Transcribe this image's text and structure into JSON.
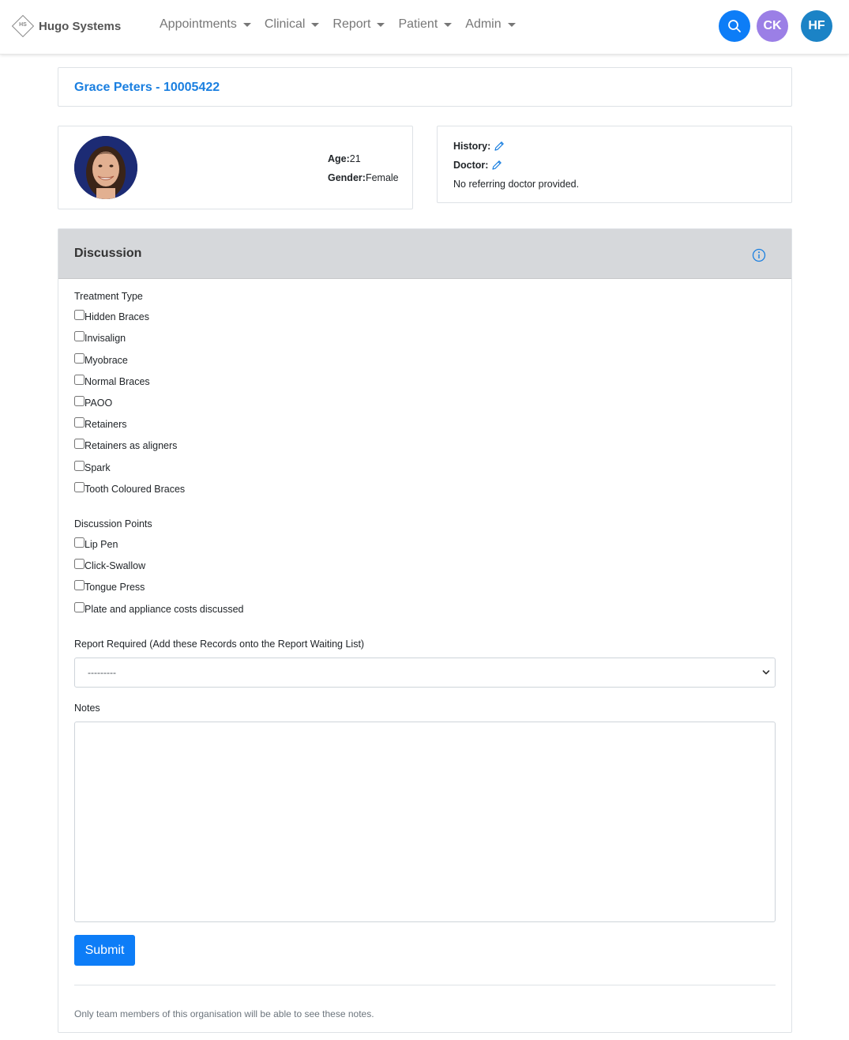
{
  "navbar": {
    "logo_text": "HS",
    "brand": "Hugo Systems",
    "menu": [
      {
        "label": "Appointments"
      },
      {
        "label": "Clinical"
      },
      {
        "label": "Report"
      },
      {
        "label": "Patient"
      },
      {
        "label": "Admin"
      }
    ],
    "user_initials_1": "CK",
    "user_initials_2": "HF",
    "accent_color": "#0d7df7"
  },
  "patient": {
    "title": "Grace Peters - 10005422",
    "age_label": "Age:",
    "age_value": "21",
    "gender_label": "Gender:",
    "gender_value": "Female",
    "history_label": "History:",
    "doctor_label": "Doctor:",
    "doctor_value": "No referring doctor provided."
  },
  "discussion": {
    "title": "Discussion",
    "treatment_type_label": "Treatment Type",
    "treatment_types": [
      "Hidden Braces",
      "Invisalign",
      "Myobrace",
      "Normal Braces",
      "PAOO",
      "Retainers",
      "Retainers as aligners",
      "Spark",
      "Tooth Coloured Braces"
    ],
    "discussion_points_label": "Discussion Points",
    "discussion_points": [
      "Lip Pen",
      "Click-Swallow",
      "Tongue Press",
      "Plate and appliance costs discussed"
    ],
    "report_required_label": "Report Required (Add these Records onto the Report Waiting List)",
    "report_required_value": "---------",
    "notes_label": "Notes",
    "notes_value": "",
    "submit_label": "Submit",
    "footer_note": "Only team members of this organisation will be able to see these notes."
  }
}
